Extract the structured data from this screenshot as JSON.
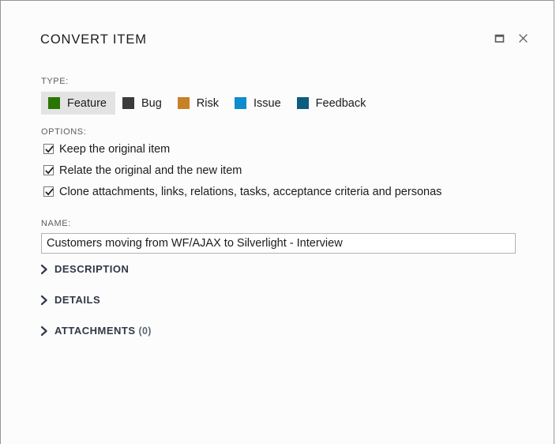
{
  "dialog": {
    "title": "CONVERT ITEM",
    "window_controls": [
      {
        "name": "restore-button",
        "icon": "restore-icon",
        "label": "Restore"
      },
      {
        "name": "close-button",
        "icon": "close-icon",
        "label": "Close"
      }
    ]
  },
  "type_section": {
    "label": "TYPE:",
    "selected": "Feature",
    "options": [
      {
        "label": "Feature",
        "color": "#2a7504",
        "selected": true
      },
      {
        "label": "Bug",
        "color": "#3b3b3b",
        "selected": false
      },
      {
        "label": "Risk",
        "color": "#c78127",
        "selected": false
      },
      {
        "label": "Issue",
        "color": "#0f8ccc",
        "selected": false
      },
      {
        "label": "Feedback",
        "color": "#0d5c7d",
        "selected": false
      }
    ]
  },
  "options_section": {
    "label": "OPTIONS:",
    "items": [
      {
        "label": "Keep the original item",
        "checked": true
      },
      {
        "label": "Relate the original and the new item",
        "checked": true
      },
      {
        "label": "Clone attachments, links, relations, tasks, acceptance criteria and personas",
        "checked": true
      }
    ]
  },
  "name_section": {
    "label": "NAME:",
    "value": "Customers moving from WF/AJAX to Silverlight - Interview",
    "placeholder": ""
  },
  "sections": [
    {
      "title": "DESCRIPTION",
      "count": "",
      "expanded": false,
      "icon": "chevron-right-icon"
    },
    {
      "title": "DETAILS",
      "count": "",
      "expanded": false,
      "icon": "chevron-right-icon"
    },
    {
      "title": "ATTACHMENTS",
      "count": "(0)",
      "expanded": false,
      "icon": "chevron-right-icon"
    }
  ],
  "colors": {
    "dialog_background": "#fcfcfc",
    "dialog_border": "#969696",
    "selected_chip": "#e3e3e3",
    "label_text": "#5c5c5c",
    "body_text": "#1b1b1b",
    "section_title": "#303846"
  }
}
